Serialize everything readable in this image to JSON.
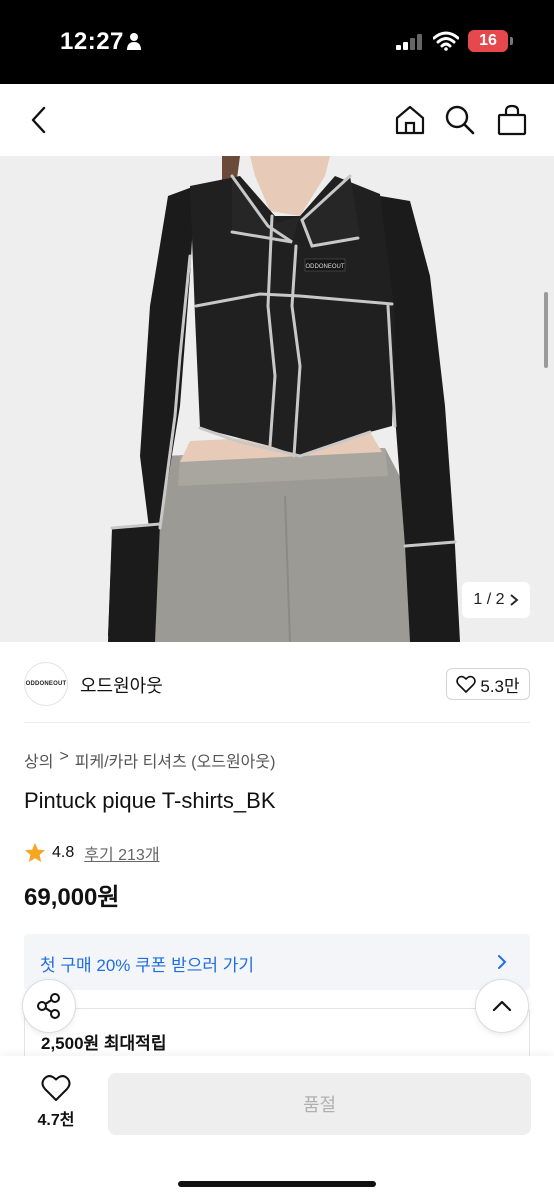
{
  "status_bar": {
    "time": "12:27",
    "battery": "16"
  },
  "image": {
    "counter": "1 / 2",
    "garment_label": "ODDONEOUT"
  },
  "brand": {
    "logo_text": "ODDONEOUT",
    "name": "오드원아웃",
    "likes": "5.3만"
  },
  "breadcrumb": {
    "category": "상의",
    "separator": ">",
    "subcategory": "피케/카라 티셔츠 (오드원아웃)"
  },
  "product": {
    "title": "Pintuck pique T-shirts_BK",
    "rating": "4.8",
    "reviews": "후기 213개",
    "price": "69,000원"
  },
  "coupon": {
    "text": "첫 구매 20% 쿠폰 받으러 가기"
  },
  "points": {
    "text": "2,500원 최대적립"
  },
  "bottom": {
    "wish_count": "4.7천",
    "buy_label": "품절"
  },
  "colors": {
    "accent": "#1f6fe0",
    "star": "#f5a623",
    "battery": "#e5484d"
  }
}
